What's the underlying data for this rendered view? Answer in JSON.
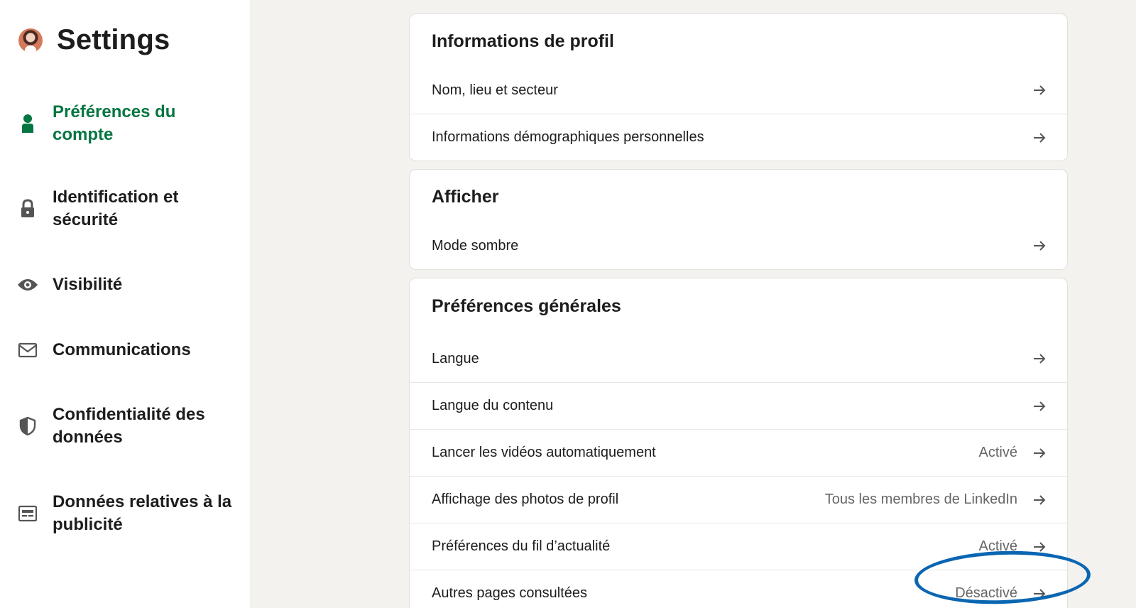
{
  "app": {
    "title": "Settings"
  },
  "sidebar": {
    "items": [
      {
        "label": "Préférences du compte",
        "icon": "person-icon",
        "active": true
      },
      {
        "label": "Identification et sécurité",
        "icon": "lock-icon",
        "active": false
      },
      {
        "label": "Visibilité",
        "icon": "eye-icon",
        "active": false
      },
      {
        "label": "Communications",
        "icon": "envelope-icon",
        "active": false
      },
      {
        "label": "Confidentialité des données",
        "icon": "shield-icon",
        "active": false
      },
      {
        "label": "Données relatives à la publicité",
        "icon": "newspaper-icon",
        "active": false
      }
    ]
  },
  "sections": {
    "profile": {
      "title": "Informations de profil",
      "rows": [
        {
          "label": "Nom, lieu et secteur"
        },
        {
          "label": "Informations démographiques personnelles"
        }
      ]
    },
    "display": {
      "title": "Afficher",
      "rows": [
        {
          "label": "Mode sombre"
        }
      ]
    },
    "general": {
      "title": "Préférences générales",
      "rows": [
        {
          "label": "Langue",
          "value": ""
        },
        {
          "label": "Langue du contenu",
          "value": ""
        },
        {
          "label": "Lancer les vidéos automatiquement",
          "value": "Activé"
        },
        {
          "label": "Affichage des photos de profil",
          "value": "Tous les membres de LinkedIn"
        },
        {
          "label": "Préférences du fil d’actualité",
          "value": "Activé"
        },
        {
          "label": "Autres pages consultées",
          "value": "Désactivé"
        }
      ]
    }
  },
  "colors": {
    "accent_green": "#057642",
    "highlight_blue": "#0b66b2",
    "page_background": "#f3f2ef"
  }
}
